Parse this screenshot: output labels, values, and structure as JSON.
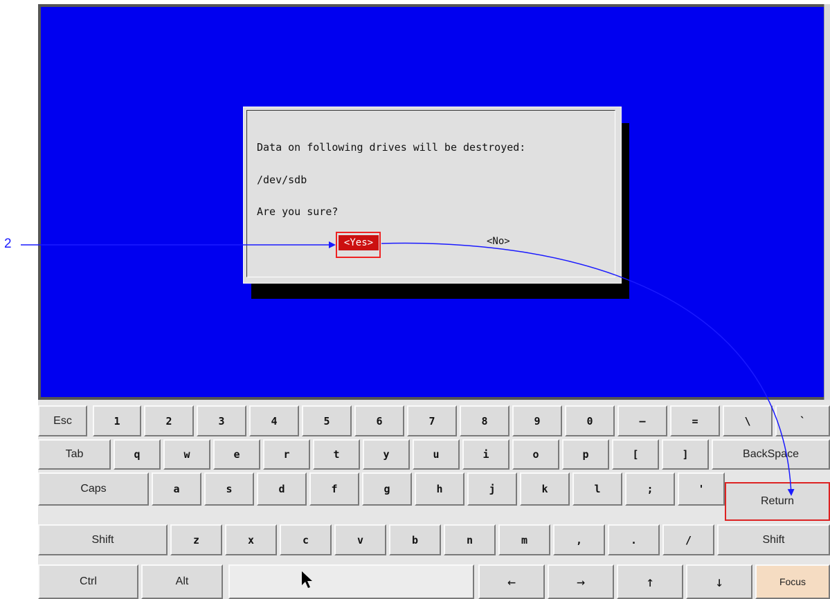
{
  "annotation": {
    "step_number": "2"
  },
  "dialog": {
    "message": "Data on following drives will be destroyed:",
    "drive": "/dev/sdb",
    "question": "Are you sure?",
    "yes_label": "<Yes>",
    "no_label": "<No>"
  },
  "keyboard": {
    "row1": [
      "Esc",
      "1",
      "2",
      "3",
      "4",
      "5",
      "6",
      "7",
      "8",
      "9",
      "0",
      "–",
      "=",
      "\\",
      "`"
    ],
    "row2": [
      "Tab",
      "q",
      "w",
      "e",
      "r",
      "t",
      "y",
      "u",
      "i",
      "o",
      "p",
      "[",
      "]",
      "BackSpace"
    ],
    "row3": [
      "Caps",
      "a",
      "s",
      "d",
      "f",
      "g",
      "h",
      "j",
      "k",
      "l",
      ";",
      "'",
      "Return"
    ],
    "row4": [
      "Shift",
      "z",
      "x",
      "c",
      "v",
      "b",
      "n",
      "m",
      ",",
      ".",
      "/",
      "Shift"
    ],
    "row5": [
      "Ctrl",
      "Alt",
      "",
      "←",
      "→",
      "↑",
      "↓",
      "Focus"
    ]
  },
  "colors": {
    "console_bg": "#0000f0",
    "highlight": "#e22222",
    "annotation": "#1a1aff",
    "focus_key": "#f5dcc2"
  }
}
